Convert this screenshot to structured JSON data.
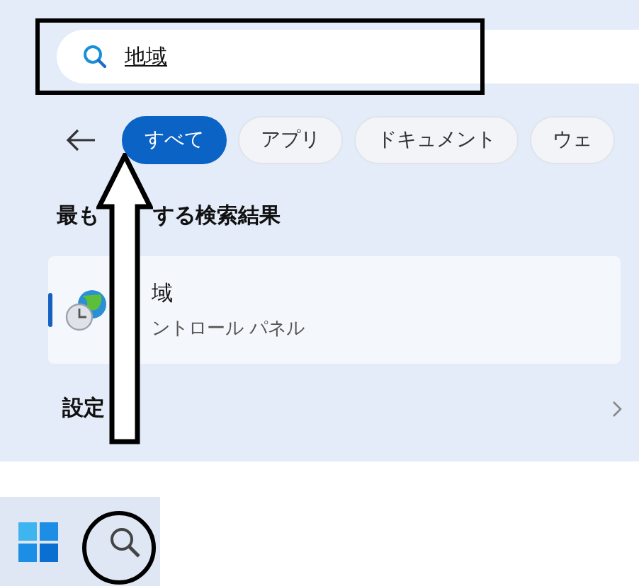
{
  "search": {
    "value": "地域"
  },
  "filters": [
    {
      "label": "すべて",
      "selected": true
    },
    {
      "label": "アプリ",
      "selected": false
    },
    {
      "label": "ドキュメント",
      "selected": false
    },
    {
      "label": "ウェ",
      "selected": false
    }
  ],
  "best_match": {
    "heading_parts": [
      "最も",
      "する検索結果"
    ],
    "title": "域",
    "subtitle": "ントロール パネル",
    "selected": true
  },
  "settings_section": {
    "label": "設定"
  }
}
